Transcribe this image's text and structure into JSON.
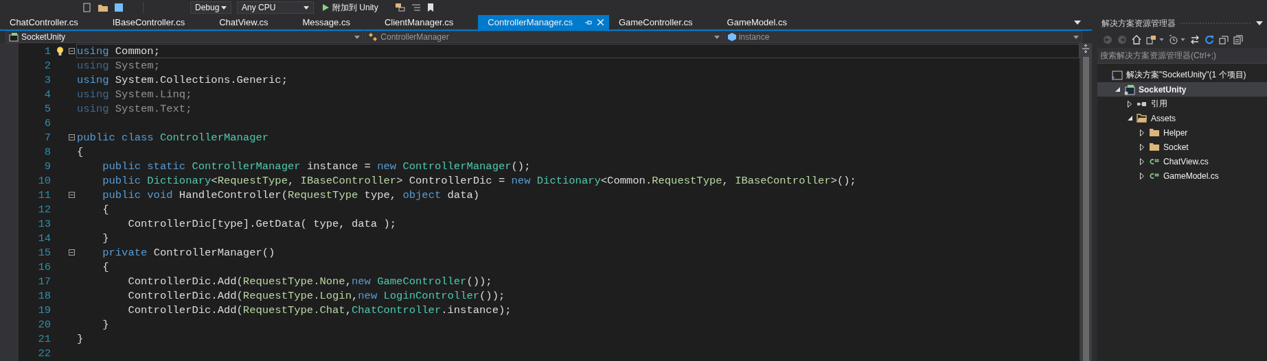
{
  "toolbar": {
    "configuration": "Debug",
    "platform": "Any CPU",
    "start": "附加到 Unity"
  },
  "tabs": [
    {
      "label": "ChatController.cs",
      "selected": false
    },
    {
      "label": "IBaseController.cs",
      "selected": false
    },
    {
      "label": "ChatView.cs",
      "selected": false
    },
    {
      "label": "Message.cs",
      "selected": false
    },
    {
      "label": "ClientManager.cs",
      "selected": false
    },
    {
      "label": "ControllerManager.cs",
      "selected": true
    },
    {
      "label": "GameController.cs",
      "selected": false
    },
    {
      "label": "GameModel.cs",
      "selected": false
    }
  ],
  "nav": {
    "project": "SocketUnity",
    "type": "ControllerManager",
    "member": "instance"
  },
  "editor": {
    "lines": [
      {
        "number": "1",
        "current": true,
        "fold": true,
        "faded": false,
        "tokens": [
          {
            "t": "using",
            "kind": "keyword"
          },
          {
            "t": " Common;",
            "kind": "plain"
          }
        ]
      },
      {
        "number": "2",
        "current": false,
        "fold": false,
        "faded": true,
        "tokens": [
          {
            "t": "using",
            "kind": "keyword"
          },
          {
            "t": " System;",
            "kind": "plain"
          }
        ]
      },
      {
        "number": "3",
        "current": false,
        "fold": false,
        "faded": false,
        "tokens": [
          {
            "t": "using",
            "kind": "keyword"
          },
          {
            "t": " System.Collections.Generic;",
            "kind": "plain"
          }
        ]
      },
      {
        "number": "4",
        "current": false,
        "fold": false,
        "faded": true,
        "tokens": [
          {
            "t": "using",
            "kind": "keyword"
          },
          {
            "t": " System.Linq;",
            "kind": "plain"
          }
        ]
      },
      {
        "number": "5",
        "current": false,
        "fold": false,
        "faded": true,
        "tokens": [
          {
            "t": "using",
            "kind": "keyword"
          },
          {
            "t": " System.Text;",
            "kind": "plain"
          }
        ]
      },
      {
        "number": "6",
        "current": false,
        "fold": false
      },
      {
        "number": "7",
        "current": false,
        "fold": true,
        "faded": false,
        "tokens": [
          {
            "t": "public class ",
            "kind": "keyword"
          },
          {
            "t": "ControllerManager",
            "kind": "type"
          }
        ]
      },
      {
        "number": "8",
        "current": false,
        "fold": false,
        "faded": false,
        "tokens": [
          {
            "t": "{",
            "kind": "plain"
          }
        ]
      },
      {
        "number": "9",
        "current": false,
        "fold": false,
        "faded": false,
        "tokens": [
          {
            "t": "    public static ",
            "kind": "keyword"
          },
          {
            "t": "ControllerManager",
            "kind": "type"
          },
          {
            "t": " instance = ",
            "kind": "plain"
          },
          {
            "t": "new ",
            "kind": "keyword"
          },
          {
            "t": "ControllerManager",
            "kind": "type"
          },
          {
            "t": "();",
            "kind": "plain"
          }
        ]
      },
      {
        "number": "10",
        "current": false,
        "fold": false,
        "faded": false,
        "tokens": [
          {
            "t": "    public ",
            "kind": "keyword"
          },
          {
            "t": "Dictionary",
            "kind": "type"
          },
          {
            "t": "<",
            "kind": "plain"
          },
          {
            "t": "RequestType",
            "kind": "enum"
          },
          {
            "t": ", ",
            "kind": "plain"
          },
          {
            "t": "IBaseController",
            "kind": "enum"
          },
          {
            "t": "> ControllerDic = ",
            "kind": "plain"
          },
          {
            "t": "new ",
            "kind": "keyword"
          },
          {
            "t": "Dictionary",
            "kind": "type"
          },
          {
            "t": "<Common.",
            "kind": "plain"
          },
          {
            "t": "RequestType",
            "kind": "enum"
          },
          {
            "t": ", ",
            "kind": "plain"
          },
          {
            "t": "IBaseController",
            "kind": "enum"
          },
          {
            "t": ">();",
            "kind": "plain"
          }
        ]
      },
      {
        "number": "11",
        "current": false,
        "fold": true,
        "faded": false,
        "tokens": [
          {
            "t": "    public void ",
            "kind": "keyword"
          },
          {
            "t": "HandleController(",
            "kind": "plain"
          },
          {
            "t": "RequestType",
            "kind": "enum"
          },
          {
            "t": " type, ",
            "kind": "plain"
          },
          {
            "t": "object",
            "kind": "keyword"
          },
          {
            "t": " data)",
            "kind": "plain"
          }
        ]
      },
      {
        "number": "12",
        "current": false,
        "fold": false,
        "faded": false,
        "tokens": [
          {
            "t": "    {",
            "kind": "plain"
          }
        ]
      },
      {
        "number": "13",
        "current": false,
        "fold": false,
        "faded": false,
        "tokens": [
          {
            "t": "        ControllerDic[type].GetData( type, data );",
            "kind": "plain"
          }
        ]
      },
      {
        "number": "14",
        "current": false,
        "fold": false,
        "faded": false,
        "tokens": [
          {
            "t": "    }",
            "kind": "plain"
          }
        ]
      },
      {
        "number": "15",
        "current": false,
        "fold": true,
        "faded": false,
        "tokens": [
          {
            "t": "    private ",
            "kind": "keyword"
          },
          {
            "t": "ControllerManager()",
            "kind": "plain"
          }
        ]
      },
      {
        "number": "16",
        "current": false,
        "fold": false,
        "faded": false,
        "tokens": [
          {
            "t": "    {",
            "kind": "plain"
          }
        ]
      },
      {
        "number": "17",
        "current": false,
        "fold": false,
        "faded": false,
        "tokens": [
          {
            "t": "        ControllerDic.Add(",
            "kind": "plain"
          },
          {
            "t": "RequestType.None",
            "kind": "enum"
          },
          {
            "t": ",",
            "kind": "plain"
          },
          {
            "t": "new ",
            "kind": "keyword"
          },
          {
            "t": "GameController",
            "kind": "type"
          },
          {
            "t": "());",
            "kind": "plain"
          }
        ]
      },
      {
        "number": "18",
        "current": false,
        "fold": false,
        "faded": false,
        "tokens": [
          {
            "t": "        ControllerDic.Add(",
            "kind": "plain"
          },
          {
            "t": "RequestType.Login",
            "kind": "enum"
          },
          {
            "t": ",",
            "kind": "plain"
          },
          {
            "t": "new ",
            "kind": "keyword"
          },
          {
            "t": "LoginController",
            "kind": "type"
          },
          {
            "t": "());",
            "kind": "plain"
          }
        ]
      },
      {
        "number": "19",
        "current": false,
        "fold": false,
        "faded": false,
        "tokens": [
          {
            "t": "        ControllerDic.Add(",
            "kind": "plain"
          },
          {
            "t": "RequestType.Chat",
            "kind": "enum"
          },
          {
            "t": ",",
            "kind": "plain"
          },
          {
            "t": "ChatController",
            "kind": "type"
          },
          {
            "t": ".instance);",
            "kind": "plain"
          }
        ]
      },
      {
        "number": "20",
        "current": false,
        "fold": false,
        "faded": false,
        "tokens": [
          {
            "t": "    }",
            "kind": "plain"
          }
        ]
      },
      {
        "number": "21",
        "current": false,
        "fold": false,
        "faded": false,
        "tokens": [
          {
            "t": "}",
            "kind": "plain"
          }
        ]
      },
      {
        "number": "22",
        "current": false,
        "fold": false
      }
    ]
  },
  "explorer": {
    "title": "解决方案资源管理器",
    "search": {
      "placeholder": "搜索解决方案资源管理器(Ctrl+;)"
    },
    "tree": [
      {
        "label": "解决方案\"SocketUnity\"(1 个项目)",
        "kind": "solution",
        "selected": false,
        "children": [
          {
            "label": "SocketUnity",
            "kind": "project",
            "expanded": true,
            "selected": true,
            "children": [
              {
                "label": "引用",
                "kind": "references",
                "expanded": false,
                "selected": false
              },
              {
                "label": "Assets",
                "kind": "folder",
                "expanded": true,
                "selected": false,
                "children": [
                  {
                    "label": "Helper",
                    "kind": "folder",
                    "expanded": false,
                    "selected": false
                  },
                  {
                    "label": "Socket",
                    "kind": "folder",
                    "expanded": false,
                    "selected": false
                  },
                  {
                    "label": "ChatView.cs",
                    "kind": "csfile",
                    "expanded": false,
                    "selected": false
                  },
                  {
                    "label": "GameModel.cs",
                    "kind": "csfile",
                    "expanded": false,
                    "selected": false
                  }
                ]
              }
            ]
          }
        ]
      }
    ]
  }
}
